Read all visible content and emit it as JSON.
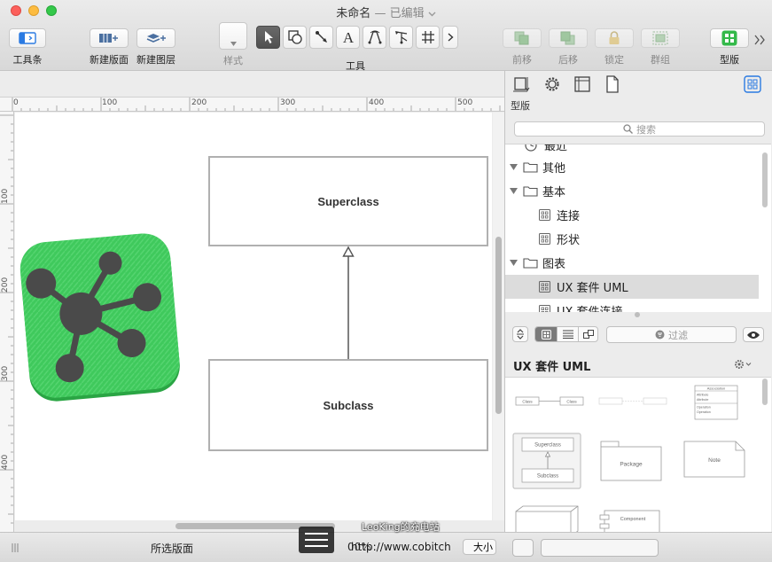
{
  "window": {
    "title": "未命名",
    "edited": "— 已编辑",
    "title_chevron": "chevron-down-icon"
  },
  "toolbar": {
    "toolbar_label": "工具条",
    "new_canvas_label": "新建版面",
    "new_layer_label": "新建图层",
    "style_label": "样式",
    "tools_label": "工具",
    "forward_label": "前移",
    "backward_label": "后移",
    "lock_label": "锁定",
    "group_label": "群组",
    "stencils_label": "型版",
    "tool_icons": [
      "pointer-icon",
      "shape-icon",
      "line-icon",
      "text-icon",
      "pen-icon",
      "diagram-icon",
      "grid-icon"
    ]
  },
  "rulers": {
    "horizontal": [
      "0",
      "100",
      "200",
      "300",
      "400",
      "500"
    ],
    "vertical": [
      "100",
      "200",
      "300",
      "400"
    ]
  },
  "canvas": {
    "superclass": "Superclass",
    "subclass": "Subclass"
  },
  "statusbar": {
    "selected_canvas": "所选版面",
    "zoom_partial": "00%",
    "fit_label": "大小",
    "watermark_line1": "LeoKing的充电站",
    "watermark_line2": "http://www.cobitch"
  },
  "sidebar": {
    "title": "型版",
    "search_placeholder": "搜索",
    "tree": [
      {
        "label": "最近",
        "kind": "clock",
        "depth": 0,
        "expanded": false,
        "partial": true
      },
      {
        "label": "其他",
        "kind": "folder",
        "depth": 0,
        "expanded": true
      },
      {
        "label": "基本",
        "kind": "folder",
        "depth": 0,
        "expanded": true
      },
      {
        "label": "连接",
        "kind": "stencil",
        "depth": 1
      },
      {
        "label": "形状",
        "kind": "stencil",
        "depth": 1
      },
      {
        "label": "图表",
        "kind": "folder",
        "depth": 0,
        "expanded": true
      },
      {
        "label": "UX 套件 UML",
        "kind": "stencil",
        "depth": 1,
        "selected": true
      },
      {
        "label": "UX 套件连接",
        "kind": "stencil",
        "depth": 1,
        "partial": true
      }
    ],
    "filter_placeholder": "过滤",
    "library_title": "UX 套件 UML",
    "stencils": {
      "class_a": "Class",
      "class_b": "Class",
      "superclass": "Superclass",
      "subclass": "Subclass",
      "package": "Package",
      "note": "Note",
      "component": "Component",
      "assoc_title": "Association",
      "assoc_rows": [
        "Attribute",
        "Attribute",
        "Operation",
        "Operation"
      ]
    }
  },
  "colors": {
    "accent": "#2a7ae2",
    "app_icon_green": "#3cc45a",
    "toolbar_green": "#34b94a"
  }
}
